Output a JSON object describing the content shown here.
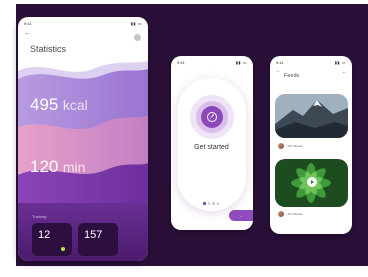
{
  "statistics": {
    "title": "Statistics",
    "time": "9:41",
    "metric1": {
      "value": "495",
      "unit": "kcal"
    },
    "metric2": {
      "value": "120",
      "unit": "min"
    },
    "training_label": "Training",
    "cards": [
      {
        "value": "12"
      },
      {
        "value": "157"
      }
    ]
  },
  "onboarding": {
    "time": "9:41",
    "cta": "Get started",
    "next_label": "Next"
  },
  "feeds": {
    "time": "9:41",
    "title": "Feeds",
    "users": [
      {
        "name": "John Brown"
      },
      {
        "name": "John Brown"
      }
    ]
  },
  "colors": {
    "background": "#2a1039",
    "accent": "#8f4cbd",
    "wave_lilac": "#a98ad8",
    "wave_pink": "#d28fc0",
    "wave_purple": "#7a3aa8"
  }
}
